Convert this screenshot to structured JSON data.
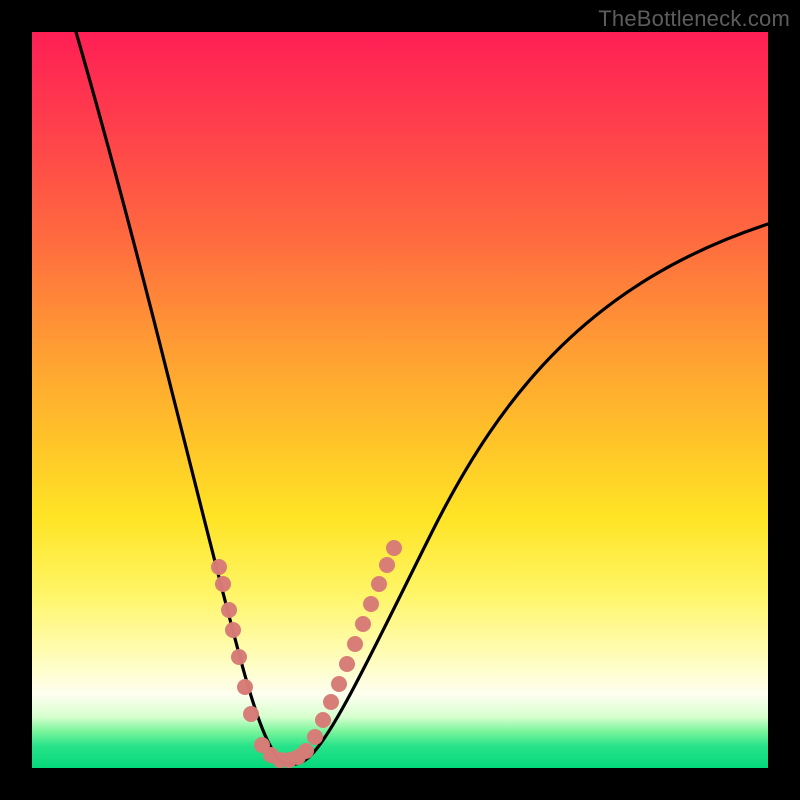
{
  "watermark": "TheBottleneck.com",
  "colors": {
    "background_frame": "#000000",
    "curve": "#000000",
    "dots": "#d87c77",
    "watermark_text": "#5d5d5d"
  },
  "chart_data": {
    "type": "line",
    "title": "",
    "xlabel": "",
    "ylabel": "",
    "xlim": [
      0,
      100
    ],
    "ylim": [
      0,
      100
    ],
    "grid": false,
    "legend": false,
    "annotations": [
      "TheBottleneck.com"
    ],
    "series": [
      {
        "name": "bottleneck-curve",
        "x": [
          6,
          8,
          10,
          12,
          14,
          16,
          18,
          20,
          22,
          24,
          26,
          28,
          30,
          32,
          33,
          35,
          38,
          42,
          46,
          50,
          55,
          60,
          66,
          72,
          78,
          85,
          92,
          99
        ],
        "values": [
          100,
          93,
          86,
          79,
          72,
          65,
          58,
          51,
          44,
          37,
          30,
          22,
          14,
          6,
          2,
          1,
          2,
          6,
          12,
          18,
          25,
          32,
          39,
          46,
          53,
          60,
          67,
          73
        ]
      }
    ],
    "highlight_points": {
      "name": "dotted-segment",
      "left_branch": [
        [
          24,
          32
        ],
        [
          24.5,
          30
        ],
        [
          25.5,
          25
        ],
        [
          26,
          22
        ],
        [
          27,
          18
        ],
        [
          28,
          13
        ],
        [
          29,
          8
        ]
      ],
      "right_branch": [
        [
          36,
          2
        ],
        [
          37,
          3
        ],
        [
          38,
          4
        ],
        [
          39,
          6
        ],
        [
          40,
          8
        ],
        [
          41,
          11
        ],
        [
          42,
          14
        ],
        [
          43,
          17
        ],
        [
          44,
          20
        ],
        [
          45,
          23
        ],
        [
          46,
          26
        ],
        [
          47,
          29
        ]
      ],
      "trough": [
        [
          30,
          1
        ],
        [
          31,
          0.6
        ],
        [
          32,
          0.5
        ],
        [
          33,
          0.5
        ],
        [
          34,
          0.6
        ],
        [
          35,
          1
        ]
      ]
    }
  }
}
